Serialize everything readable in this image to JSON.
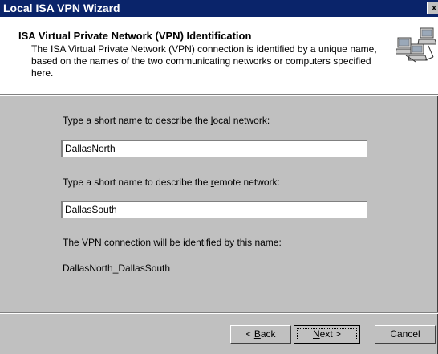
{
  "window": {
    "title": "Local ISA VPN Wizard",
    "close_glyph": "x"
  },
  "header": {
    "title": "ISA Virtual Private Network (VPN) Identification",
    "description": "The ISA Virtual Private Network (VPN) connection is identified by a unique name, based on the names of the two communicating networks or computers specified here.",
    "icon": "network-computers-icon"
  },
  "form": {
    "local_label_pre": "Type a short name to describe the ",
    "local_label_accel": "l",
    "local_label_post": "ocal network:",
    "local_value": "DallasNorth",
    "remote_label_pre": "Type a short name to describe the ",
    "remote_label_accel": "r",
    "remote_label_post": "emote network:",
    "remote_value": "DallasSouth",
    "connection_label": "The VPN connection will be identified by this name:",
    "connection_name": "DallasNorth_DallasSouth"
  },
  "buttons": {
    "back_pre": "< ",
    "back_accel": "B",
    "back_post": "ack",
    "next_accel": "N",
    "next_post": "ext >",
    "cancel": "Cancel"
  },
  "colors": {
    "titlebar": "#0a246a",
    "dialog_face": "#c0c0c0",
    "header_bg": "#ffffff"
  }
}
